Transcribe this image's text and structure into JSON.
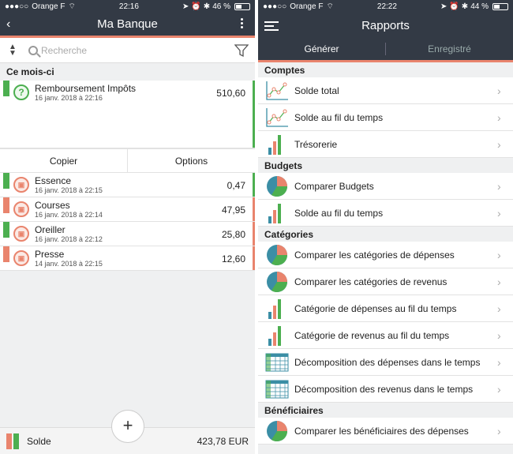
{
  "left": {
    "status": {
      "carrier": "Orange F",
      "time": "22:16",
      "battery": "46 %",
      "battery_level": 0.46
    },
    "title": "Ma Banque",
    "search_placeholder": "Recherche",
    "section": "Ce mois-ci",
    "transactions": [
      {
        "name": "Remboursement Impôts",
        "date": "16 janv. 2018 à 22:16",
        "amount": "510,60",
        "type": "income"
      },
      {
        "name": "Essence",
        "date": "16 janv. 2018 à 22:15",
        "amount": "0,47",
        "type": "income"
      },
      {
        "name": "Courses",
        "date": "16 janv. 2018 à 22:14",
        "amount": "47,95",
        "type": "expense"
      },
      {
        "name": "Oreiller",
        "date": "16 janv. 2018 à 22:12",
        "amount": "25,80",
        "type": "income"
      },
      {
        "name": "Presse",
        "date": "14 janv. 2018 à 22:15",
        "amount": "12,60",
        "type": "expense"
      }
    ],
    "actions": {
      "copy": "Copier",
      "options": "Options"
    },
    "balance_label": "Solde",
    "balance_value": "423,78 EUR",
    "fab": "+"
  },
  "right": {
    "status": {
      "carrier": "Orange F",
      "time": "22:22",
      "battery": "44 %",
      "battery_level": 0.44
    },
    "title": "Rapports",
    "tabs": {
      "generate": "Générer",
      "saved": "Enregistré"
    },
    "sections": [
      {
        "title": "Comptes",
        "items": [
          {
            "label": "Solde total",
            "icon": "line-chart-icon"
          },
          {
            "label": "Solde au fil du temps",
            "icon": "line-chart-icon"
          },
          {
            "label": "Trésorerie",
            "icon": "bar-chart-icon"
          }
        ]
      },
      {
        "title": "Budgets",
        "items": [
          {
            "label": "Comparer Budgets",
            "icon": "pie-chart-icon"
          },
          {
            "label": "Solde au fil du temps",
            "icon": "bar-chart-icon"
          }
        ]
      },
      {
        "title": "Catégories",
        "items": [
          {
            "label": "Comparer les catégories de dépenses",
            "icon": "pie-chart-icon"
          },
          {
            "label": "Comparer les catégories de revenus",
            "icon": "pie-chart-icon"
          },
          {
            "label": "Catégorie de dépenses au fil du temps",
            "icon": "bar-chart-icon"
          },
          {
            "label": "Catégorie de revenus au fil du temps",
            "icon": "bar-chart-icon"
          },
          {
            "label": "Décomposition des dépenses dans le temps",
            "icon": "table-icon"
          },
          {
            "label": "Décomposition des revenus dans le temps",
            "icon": "table-icon"
          }
        ]
      },
      {
        "title": "Bénéficiaires",
        "items": [
          {
            "label": "Comparer les bénéficiaires des dépenses",
            "icon": "pie-chart-icon"
          }
        ]
      }
    ]
  },
  "colors": {
    "header": "#333a45",
    "accent": "#e9846d",
    "income": "#4caf50",
    "expense": "#e9846d",
    "teal": "#3b8ea5"
  }
}
